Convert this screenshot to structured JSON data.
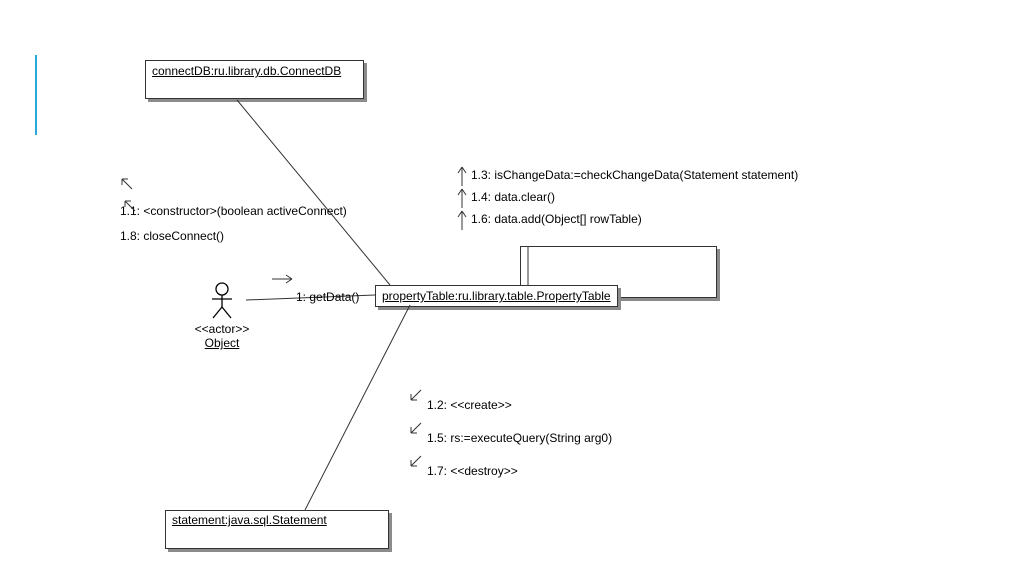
{
  "nodes": {
    "connectDB": {
      "label": "connectDB:ru.library.db.ConnectDB"
    },
    "propertyTable": {
      "label": "propertyTable:ru.library.table.PropertyTable"
    },
    "statement": {
      "label": "statement:java.sql.Statement"
    },
    "actor": {
      "stereotype": "<<actor>>",
      "name": "Object"
    }
  },
  "messages": {
    "m1": "1: getData()",
    "m11": "1.1: <constructor>(boolean activeConnect)",
    "m18": "1.8: closeConnect()",
    "m13": "1.3: isChangeData:=checkChangeData(Statement statement)",
    "m14": "1.4: data.clear()",
    "m16": "1.6: data.add(Object[] rowTable)",
    "m12": "1.2: <<create>>",
    "m15": "1.5: rs:=executeQuery(String arg0)",
    "m17": "1.7: <<destroy>>"
  }
}
